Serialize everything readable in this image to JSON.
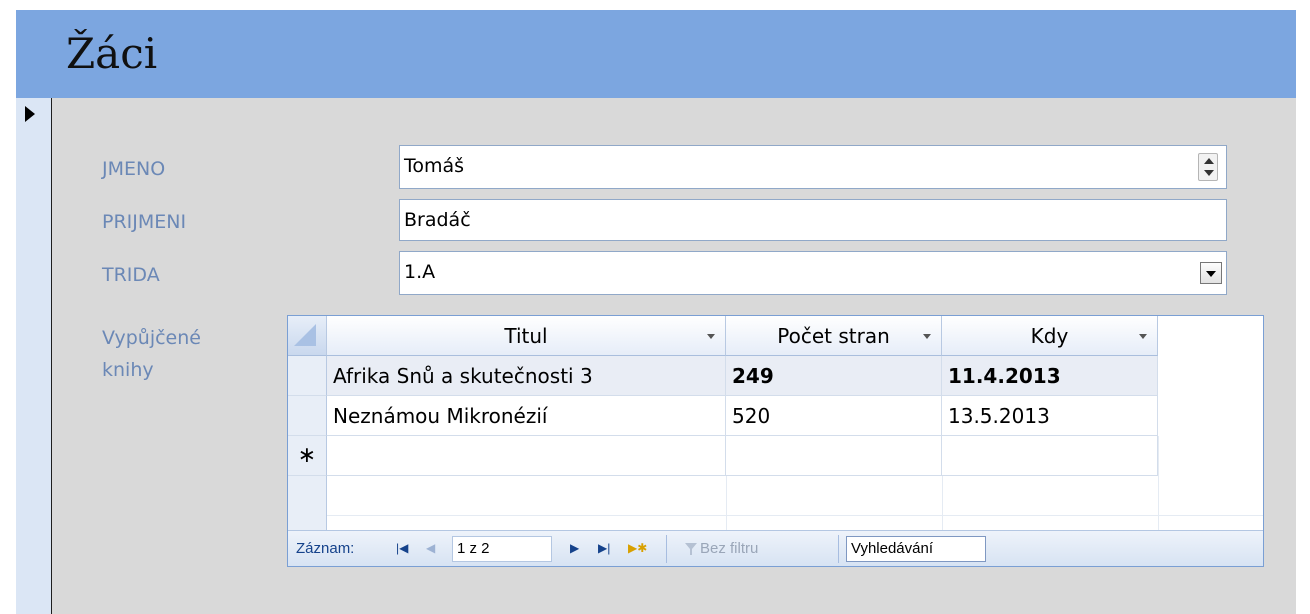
{
  "form": {
    "title": "Žáci",
    "record_selector_icon": "current-record-arrow-icon"
  },
  "fields": {
    "jmeno": {
      "label": "JMENO",
      "value": "Tomáš"
    },
    "prijmeni": {
      "label": "PRIJMENI",
      "value": "Bradáč"
    },
    "trida": {
      "label": "TRIDA",
      "value": "1.A"
    }
  },
  "subform": {
    "label_line1": "Vypůjčené",
    "label_line2": "knihy",
    "columns": [
      "Titul",
      "Počet stran",
      "Kdy"
    ],
    "rows": [
      {
        "titul": "Afrika Snů a skutečnosti 3",
        "pocet": "249",
        "kdy": "11.4.2013"
      },
      {
        "titul": "Neznámou Mikronézií",
        "pocet": "520",
        "kdy": "13.5.2013"
      }
    ],
    "new_row_marker": "∗"
  },
  "navigation": {
    "label": "Záznam:",
    "position": "1 z 2",
    "filter": "Bez filtru",
    "search": "Vyhledávání"
  },
  "colors": {
    "header": "#7ca6e0",
    "label": "#6b88b6",
    "background": "#d9d9d9"
  }
}
